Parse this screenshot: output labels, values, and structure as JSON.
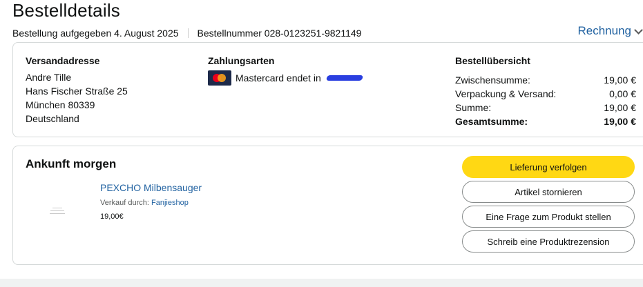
{
  "header": {
    "title": "Bestelldetails",
    "order_placed": "Bestellung aufgegeben 4. August 2025",
    "order_number": "Bestellnummer 028-0123251-9821149",
    "invoice_label": "Rechnung"
  },
  "shipping": {
    "heading": "Versandadresse",
    "lines": [
      "Andre Tille",
      "Hans Fischer Straße 25",
      "München 80339",
      "Deutschland"
    ]
  },
  "payment": {
    "heading": "Zahlungsarten",
    "method": "Mastercard endet in"
  },
  "summary": {
    "heading": "Bestellübersicht",
    "rows": [
      {
        "label": "Zwischensumme:",
        "value": "19,00 €"
      },
      {
        "label": "Verpackung & Versand:",
        "value": "0,00 €"
      },
      {
        "label": "Summe:",
        "value": "19,00 €"
      },
      {
        "label": "Gesamtsumme:",
        "value": "19,00 €"
      }
    ]
  },
  "shipment": {
    "status": "Ankunft morgen",
    "product_name": "PEXCHO Milbensauger",
    "seller_prefix": "Verkauf durch:",
    "seller_name": "Fanjieshop",
    "price": "19,00€"
  },
  "actions": {
    "track": "Lieferung verfolgen",
    "cancel": "Artikel stornieren",
    "question": "Eine Frage zum Produkt stellen",
    "review": "Schreib eine Produktrezension"
  },
  "colors": {
    "primary_button": "#ffd814",
    "link": "#2162a1",
    "border": "#d5d9d9"
  }
}
